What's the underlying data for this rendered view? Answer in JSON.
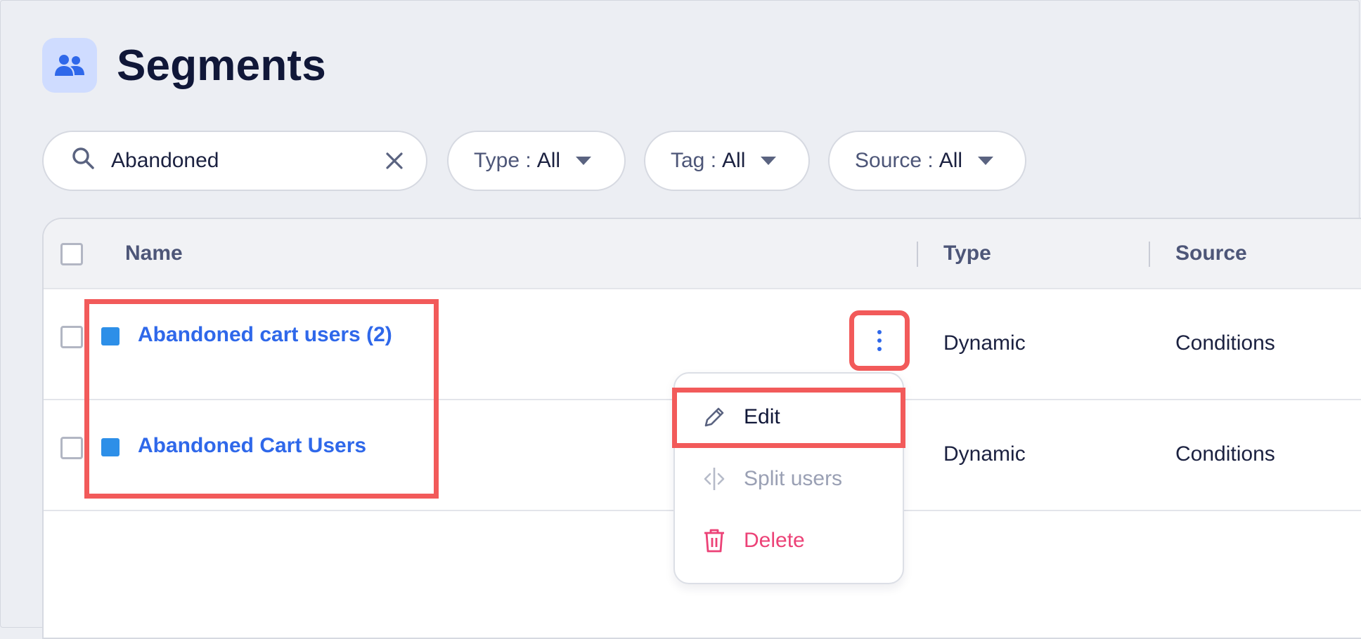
{
  "header": {
    "title": "Segments",
    "icon": "users-icon"
  },
  "search": {
    "value": "Abandoned"
  },
  "filters": [
    {
      "label": "Type :",
      "value": "All"
    },
    {
      "label": "Tag :",
      "value": "All"
    },
    {
      "label": "Source :",
      "value": "All"
    }
  ],
  "table": {
    "columns": {
      "name": "Name",
      "type": "Type",
      "source": "Source"
    },
    "rows": [
      {
        "name": "Abandoned cart users (2)",
        "type": "Dynamic",
        "source": "Conditions"
      },
      {
        "name": "Abandoned Cart Users",
        "type": "Dynamic",
        "source": "Conditions"
      }
    ]
  },
  "context_menu": {
    "edit": "Edit",
    "split": "Split users",
    "delete": "Delete"
  },
  "colors": {
    "accent": "#2f68ea",
    "highlight": "#f25a5a",
    "danger": "#ec4277",
    "segment_color": "#2d8fe8"
  }
}
